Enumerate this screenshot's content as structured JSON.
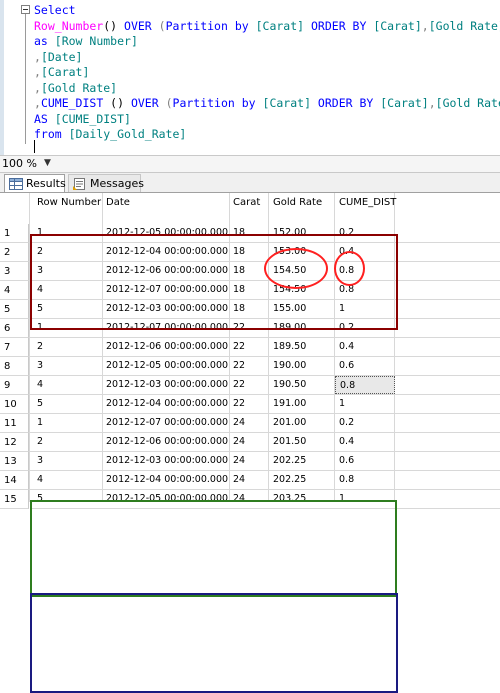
{
  "query": {
    "lines": [
      [
        {
          "t": "Select",
          "c": "kw"
        }
      ],
      [
        {
          "t": "Row_Number",
          "c": "fn"
        },
        {
          "t": "() ",
          "c": ""
        },
        {
          "t": "OVER",
          "c": "kw"
        },
        {
          "t": " (",
          "c": "gr"
        },
        {
          "t": "Partition by",
          "c": "kw"
        },
        {
          "t": " [Carat] ",
          "c": "id"
        },
        {
          "t": "ORDER BY",
          "c": "kw"
        },
        {
          "t": " [Carat]",
          "c": "id"
        },
        {
          "t": ",",
          "c": "gr"
        },
        {
          "t": "[Gold Rate]",
          "c": "id"
        },
        {
          "t": ")",
          "c": "gr"
        }
      ],
      [
        {
          "t": "as",
          "c": "kw"
        },
        {
          "t": " [Row Number]",
          "c": "id"
        }
      ],
      [
        {
          "t": ",",
          "c": "gr"
        },
        {
          "t": "[Date]",
          "c": "id"
        }
      ],
      [
        {
          "t": ",",
          "c": "gr"
        },
        {
          "t": "[Carat]",
          "c": "id"
        }
      ],
      [
        {
          "t": ",",
          "c": "gr"
        },
        {
          "t": "[Gold Rate]",
          "c": "id"
        }
      ],
      [
        {
          "t": ",",
          "c": "gr"
        },
        {
          "t": "CUME_DIST",
          "c": "kw"
        },
        {
          "t": " () ",
          "c": ""
        },
        {
          "t": "OVER",
          "c": "kw"
        },
        {
          "t": " (",
          "c": "gr"
        },
        {
          "t": "Partition by",
          "c": "kw"
        },
        {
          "t": " [Carat] ",
          "c": "id"
        },
        {
          "t": "ORDER BY",
          "c": "kw"
        },
        {
          "t": " [Carat]",
          "c": "id"
        },
        {
          "t": ",",
          "c": "gr"
        },
        {
          "t": "[Gold Rate]",
          "c": "id"
        },
        {
          "t": ")",
          "c": "gr"
        }
      ],
      [
        {
          "t": "AS",
          "c": "kw"
        },
        {
          "t": " [CUME_DIST]",
          "c": "id"
        }
      ],
      [
        {
          "t": "from",
          "c": "kw"
        },
        {
          "t": " [Daily_Gold_Rate]",
          "c": "id"
        }
      ]
    ]
  },
  "zoom": "100 %",
  "tabs": {
    "results": "Results",
    "messages": "Messages"
  },
  "grid": {
    "columns": [
      "Row Number",
      "Date",
      "Carat",
      "Gold Rate",
      "CUME_DIST"
    ],
    "rows": [
      [
        "1",
        "2012-12-05 00:00:00.000",
        "18",
        "152.00",
        "0.2"
      ],
      [
        "2",
        "2012-12-04 00:00:00.000",
        "18",
        "153.00",
        "0.4"
      ],
      [
        "3",
        "2012-12-06 00:00:00.000",
        "18",
        "154.50",
        "0.8"
      ],
      [
        "4",
        "2012-12-07 00:00:00.000",
        "18",
        "154.50",
        "0.8"
      ],
      [
        "5",
        "2012-12-03 00:00:00.000",
        "18",
        "155.00",
        "1"
      ],
      [
        "1",
        "2012-12-07 00:00:00.000",
        "22",
        "189.00",
        "0.2"
      ],
      [
        "2",
        "2012-12-06 00:00:00.000",
        "22",
        "189.50",
        "0.4"
      ],
      [
        "3",
        "2012-12-05 00:00:00.000",
        "22",
        "190.00",
        "0.6"
      ],
      [
        "4",
        "2012-12-03 00:00:00.000",
        "22",
        "190.50",
        "0.8"
      ],
      [
        "5",
        "2012-12-04 00:00:00.000",
        "22",
        "191.00",
        "1"
      ],
      [
        "1",
        "2012-12-07 00:00:00.000",
        "24",
        "201.00",
        "0.2"
      ],
      [
        "2",
        "2012-12-06 00:00:00.000",
        "24",
        "201.50",
        "0.4"
      ],
      [
        "3",
        "2012-12-03 00:00:00.000",
        "24",
        "202.25",
        "0.6"
      ],
      [
        "4",
        "2012-12-04 00:00:00.000",
        "24",
        "202.25",
        "0.8"
      ],
      [
        "5",
        "2012-12-05 00:00:00.000",
        "24",
        "203.25",
        "1"
      ]
    ],
    "row_numbers": [
      "1",
      "2",
      "3",
      "4",
      "5",
      "6",
      "7",
      "8",
      "9",
      "10",
      "11",
      "12",
      "13",
      "14",
      "15"
    ]
  },
  "colors": {
    "group_18": "#8b0000",
    "group_22": "#2e7d1f",
    "group_24": "#1a1a80",
    "annotation_circle": "#ff2020",
    "keyword": "#0000ff",
    "function": "#ff00ff",
    "identifier": "#008080"
  },
  "icons": {
    "results_tab": "grid-icon",
    "messages_tab": "messages-icon",
    "zoom_dropdown": "chevron-down-icon",
    "collapse": "collapse-minus-icon"
  }
}
